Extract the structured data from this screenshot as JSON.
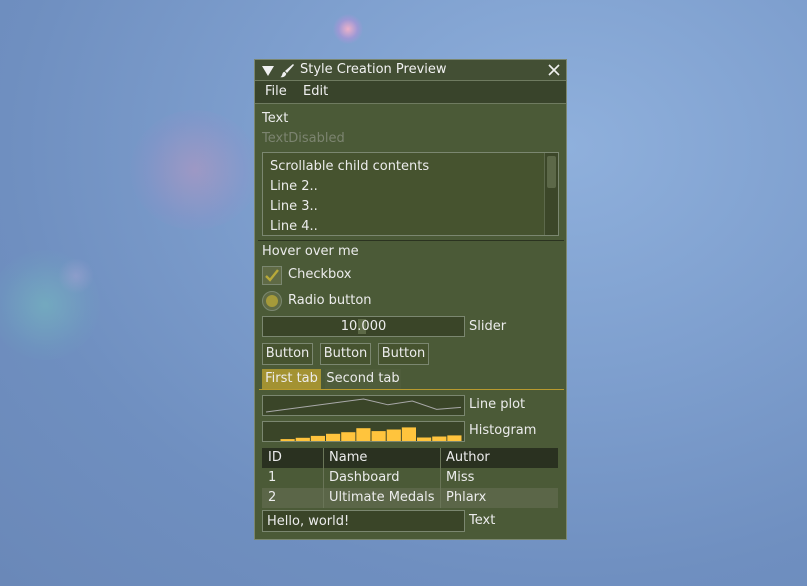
{
  "window": {
    "title": "Style Creation Preview"
  },
  "menubar": [
    "File",
    "Edit"
  ],
  "text": {
    "normal": "Text",
    "disabled": "TextDisabled"
  },
  "child": {
    "lines": [
      "Scrollable child contents",
      "Line 2..",
      "Line 3..",
      "Line 4.."
    ]
  },
  "hover": "Hover over me",
  "checkbox": {
    "label": "Checkbox",
    "checked": true
  },
  "radio": {
    "label": "Radio button",
    "selected": true
  },
  "slider": {
    "value": "10.000",
    "label": "Slider"
  },
  "buttons": [
    "Button",
    "Button",
    "Button"
  ],
  "tabs": [
    {
      "label": "First tab",
      "active": true
    },
    {
      "label": "Second tab",
      "active": false
    }
  ],
  "plots": {
    "line_label": "Line plot",
    "histogram_label": "Histogram"
  },
  "chart_data": [
    {
      "type": "line",
      "title": "",
      "y": [
        0.0,
        0.25,
        0.5,
        0.75,
        1.0,
        0.55,
        0.85,
        0.2,
        0.35
      ],
      "grid": false
    },
    {
      "type": "bar",
      "title": "",
      "values": [
        0.12,
        0.2,
        0.32,
        0.45,
        0.55,
        0.8,
        0.62,
        0.72,
        0.85,
        0.22,
        0.28,
        0.35
      ],
      "grid": false
    }
  ],
  "table": {
    "headers": [
      "ID",
      "Name",
      "Author"
    ],
    "rows": [
      [
        "1",
        "Dashboard",
        "Miss"
      ],
      [
        "2",
        "Ultimate Medals",
        "Phlarx"
      ]
    ]
  },
  "input": {
    "value": "Hello, world!",
    "label": "Text"
  },
  "colors": {
    "window_bg": "#4b5a37",
    "accent": "#a39232",
    "plot_line": "#a8a8a8",
    "histogram": "#ffc43d"
  }
}
